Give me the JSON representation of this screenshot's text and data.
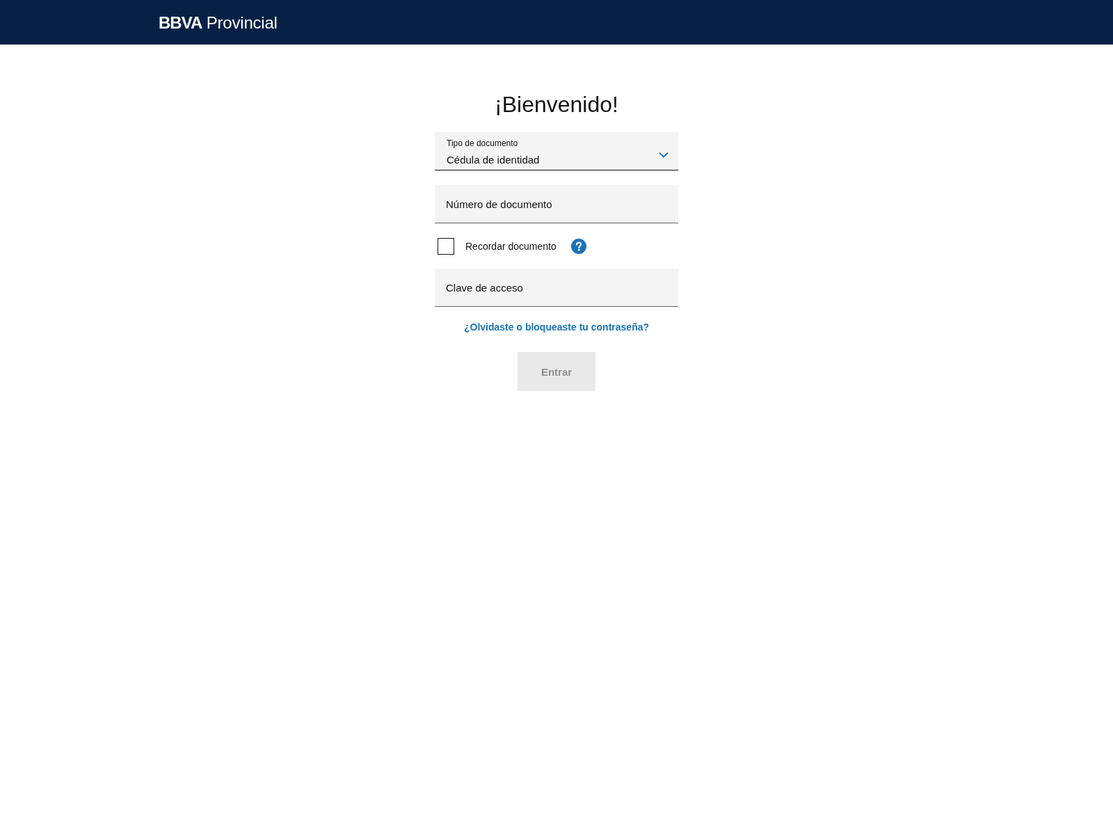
{
  "header": {
    "logo": "**BBVA** Provincial"
  },
  "title": "¡Bienvenido!",
  "form": {
    "document_type": {
      "label": "Tipo de documento",
      "value": "Cédula de identidad"
    },
    "document_number": {
      "placeholder": "Número de documento"
    },
    "remember": {
      "label": "Recordar documento",
      "checked": false
    },
    "password": {
      "placeholder": "Clave de acceso"
    },
    "forgot_link": "¿Olvidaste o bloqueaste tu contraseña?",
    "submit": {
      "label": "Entrar",
      "disabled": true
    }
  }
}
